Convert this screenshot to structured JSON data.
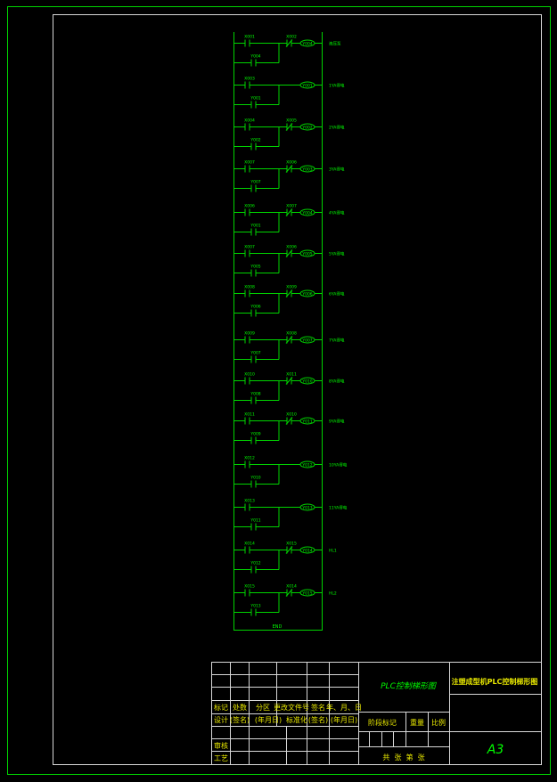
{
  "rungs": [
    {
      "in": "X001",
      "hold": "Y004",
      "nc": "X002",
      "coil": "Y004",
      "label": "液压泵"
    },
    {
      "in": "X003",
      "hold": "Y001",
      "nc": "",
      "coil": "Y001",
      "label": "1YA得电"
    },
    {
      "in": "X004",
      "hold": "Y002",
      "nc": "X005",
      "coil": "Y002",
      "label": "2YA得电"
    },
    {
      "in": "X007",
      "hold": "Y007",
      "nc": "X006",
      "coil": "Y003",
      "label": "3YA得电"
    },
    {
      "in": "X006",
      "hold": "Y001",
      "nc": "X007",
      "coil": "Y004",
      "label": "4YA得电"
    },
    {
      "in": "X007",
      "hold": "Y005",
      "nc": "X006",
      "coil": "Y005",
      "label": "5YA得电"
    },
    {
      "in": "X008",
      "hold": "Y006",
      "nc": "X009",
      "coil": "Y006",
      "label": "6YA得电"
    },
    {
      "in": "X009",
      "hold": "Y007",
      "nc": "X008",
      "coil": "Y007",
      "label": "7YA得电"
    },
    {
      "in": "X010",
      "hold": "Y008",
      "nc": "X011",
      "coil": "Y010",
      "label": "8YA得电"
    },
    {
      "in": "X011",
      "hold": "Y009",
      "nc": "X010",
      "coil": "Y011",
      "label": "9YA得电"
    },
    {
      "in": "X012",
      "hold": "Y010",
      "nc": "",
      "coil": "Y012",
      "label": "10YA得电"
    },
    {
      "in": "X013",
      "hold": "Y011",
      "nc": "",
      "coil": "Y013",
      "label": "11YA得电"
    },
    {
      "in": "X014",
      "hold": "Y012",
      "nc": "X015",
      "coil": "Y014",
      "label": "HL1"
    },
    {
      "in": "X015",
      "hold": "Y013",
      "nc": "X014",
      "coil": "Y015",
      "label": "HL2"
    }
  ],
  "end_label": "END",
  "title_block": {
    "drawing_name": "PLC控制梯形图",
    "project_name": "注塑成型机PLC控制梯形图",
    "sheet_size": "A3",
    "row_headers": [
      "标记",
      "处数",
      "分区",
      "更改文件号",
      "签名",
      "年、月、日"
    ],
    "row_design": [
      "设计",
      "(签名)",
      "(年月日)",
      "标准化",
      "(签名)",
      "(年月日)"
    ],
    "reviewer": "审核",
    "process": "工艺",
    "stage_mark": "阶段标记",
    "weight": "重量",
    "scale": "比例",
    "sheets": "共  张  第  张"
  }
}
